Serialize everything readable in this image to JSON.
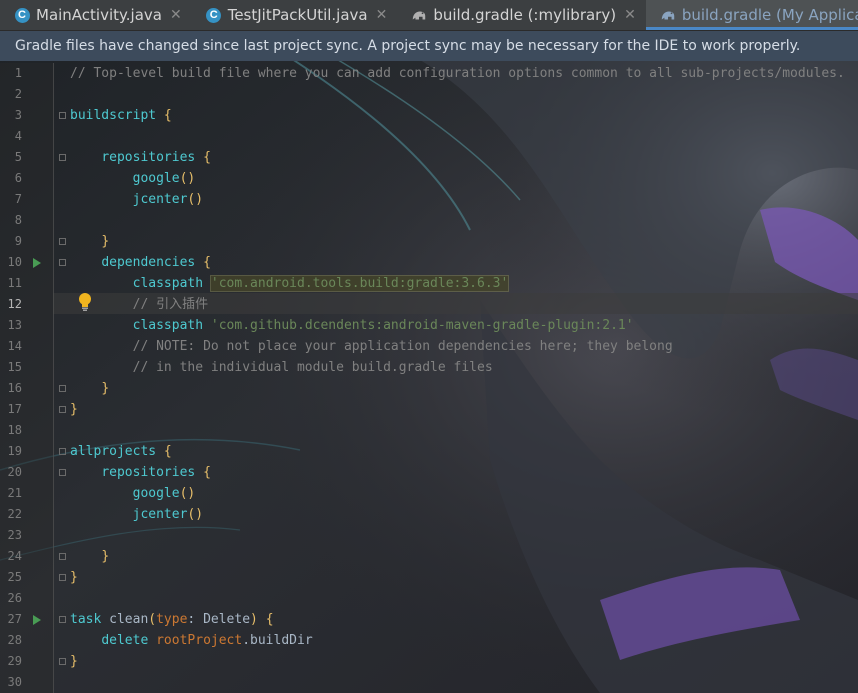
{
  "tabs": [
    {
      "label": "MainActivity.java",
      "icon": "java-class-icon"
    },
    {
      "label": "TestJitPackUtil.java",
      "icon": "java-class-icon"
    },
    {
      "label": "build.gradle (:mylibrary)",
      "icon": "gradle-icon"
    },
    {
      "label": "build.gradle (My Application)",
      "icon": "gradle-icon",
      "active": true
    }
  ],
  "notice": "Gradle files have changed since last project sync. A project sync may be necessary for the IDE to work properly.",
  "line_numbers": [
    "1",
    "2",
    "3",
    "4",
    "5",
    "6",
    "7",
    "8",
    "9",
    "10",
    "11",
    "12",
    "13",
    "14",
    "15",
    "16",
    "17",
    "18",
    "19",
    "20",
    "21",
    "22",
    "23",
    "24",
    "25",
    "26",
    "27",
    "28",
    "29",
    "30"
  ],
  "current_line": "12",
  "code": {
    "l1": "// Top-level build file where you can add configuration options common to all sub-projects/modules.",
    "l3a": "buildscript",
    "l3b": "{",
    "l5a": "repositories",
    "l5b": "{",
    "l6a": "google",
    "l6b": "()",
    "l7a": "jcenter",
    "l7b": "()",
    "l9": "}",
    "l10a": "dependencies",
    "l10b": "{",
    "l11a": "classpath",
    "l11b": "'com.android.tools.build:gradle:3.6.3'",
    "l12": "// 引入插件",
    "l13a": "classpath",
    "l13b": "'com.github.dcendents:android-maven-gradle-plugin:2.1'",
    "l14": "// NOTE: Do not place your application dependencies here; they belong",
    "l15": "// in the individual module build.gradle files",
    "l16": "}",
    "l17": "}",
    "l19a": "allprojects",
    "l19b": "{",
    "l20a": "repositories",
    "l20b": "{",
    "l21a": "google",
    "l21b": "()",
    "l22a": "jcenter",
    "l22b": "()",
    "l24": "}",
    "l25": "}",
    "l27a": "task",
    "l27b": "clean",
    "l27c": "(",
    "l27d": "type",
    "l27e": ":",
    "l27f": "Delete",
    "l27g": ")",
    "l27h": "{",
    "l28a": "delete",
    "l28b": "rootProject",
    "l28c": ".buildDir",
    "l29": "}"
  },
  "colors": {
    "accent": "#4a88c7",
    "notice_bg": "#3d4b5c",
    "tab_bar_bg": "#3c3f41",
    "comment": "#808080",
    "string": "#6a8759",
    "identifier": "#4ec9d0",
    "brace": "#e8bf6a"
  }
}
